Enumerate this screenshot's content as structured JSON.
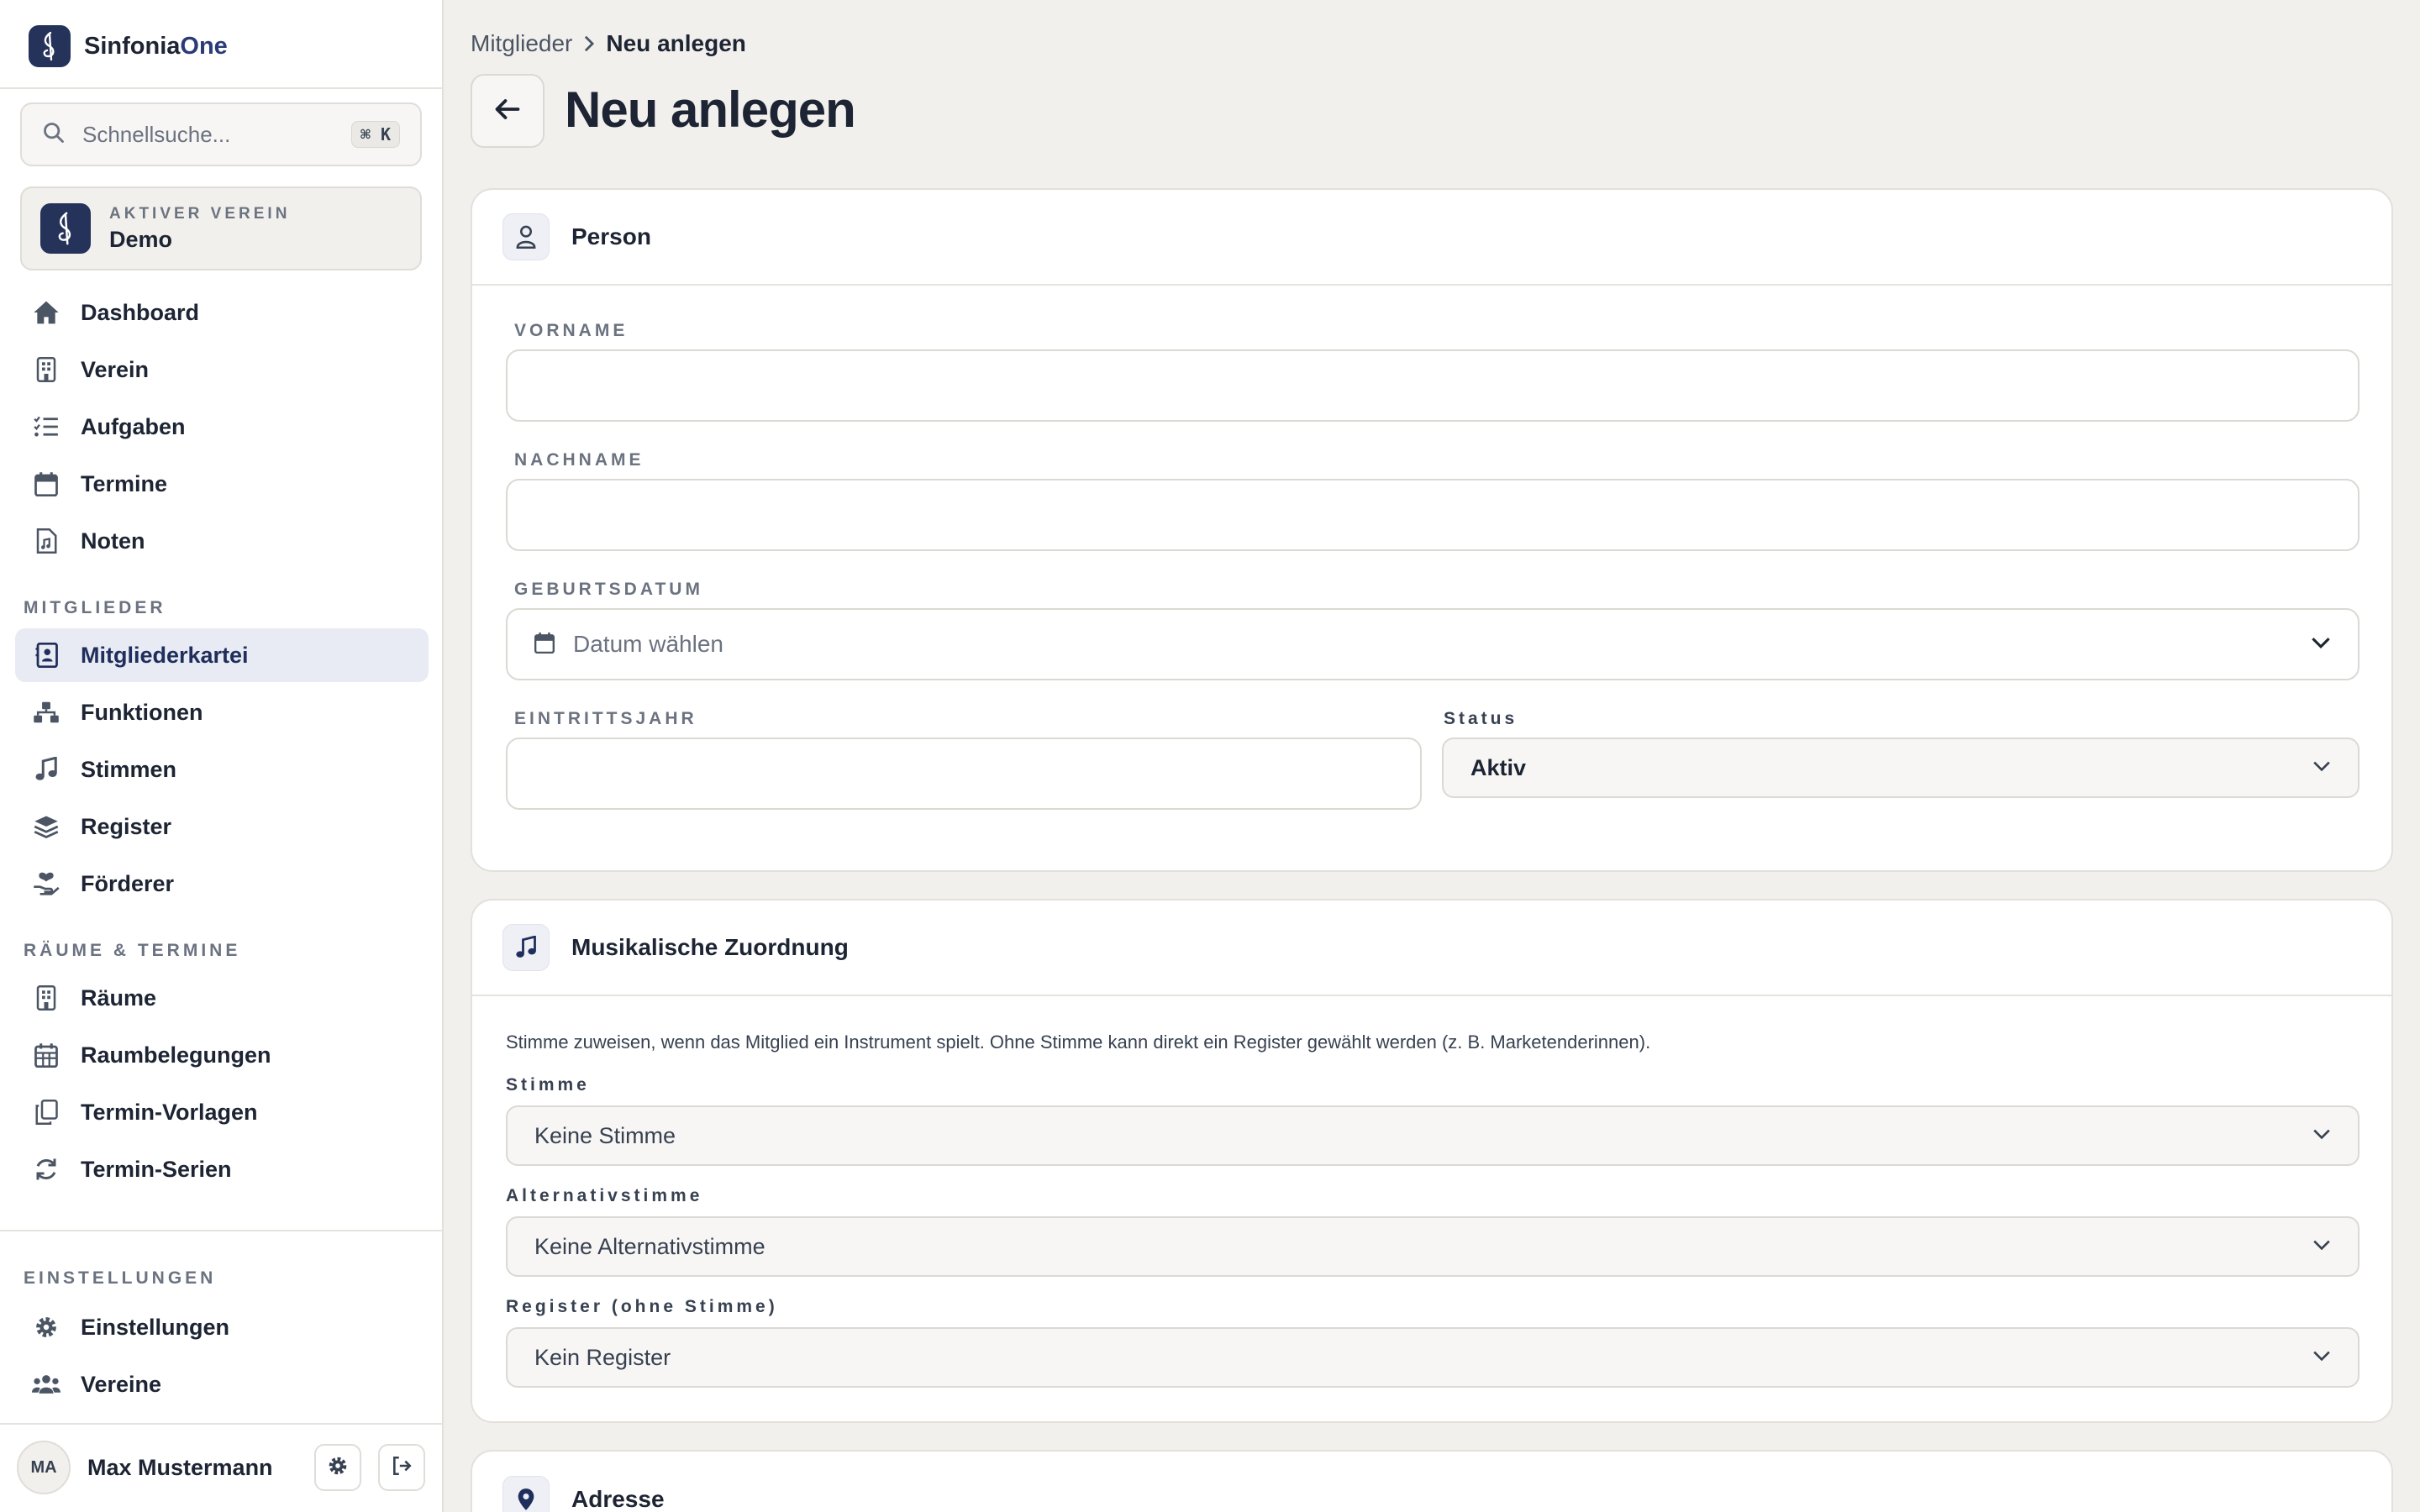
{
  "brand": {
    "name_part1": "Sinfonia",
    "name_part2": "One"
  },
  "search": {
    "placeholder": "Schnellsuche...",
    "shortcut": "⌘ K"
  },
  "active_club": {
    "label": "AKTIVER VEREIN",
    "name": "Demo"
  },
  "nav": {
    "main": [
      {
        "label": "Dashboard",
        "icon": "home-icon"
      },
      {
        "label": "Verein",
        "icon": "building-icon"
      },
      {
        "label": "Aufgaben",
        "icon": "list-check-icon"
      },
      {
        "label": "Termine",
        "icon": "calendar-icon"
      },
      {
        "label": "Noten",
        "icon": "sheet-music-icon"
      }
    ],
    "sections": [
      {
        "title": "MITGLIEDER",
        "items": [
          {
            "label": "Mitgliederkartei",
            "icon": "address-card-icon",
            "active": true
          },
          {
            "label": "Funktionen",
            "icon": "hierarchy-icon"
          },
          {
            "label": "Stimmen",
            "icon": "music-note-icon"
          },
          {
            "label": "Register",
            "icon": "layers-icon"
          },
          {
            "label": "Förderer",
            "icon": "hand-heart-icon"
          }
        ]
      },
      {
        "title": "RÄUME & TERMINE",
        "items": [
          {
            "label": "Räume",
            "icon": "building-icon"
          },
          {
            "label": "Raumbelegungen",
            "icon": "calendar-grid-icon"
          },
          {
            "label": "Termin-Vorlagen",
            "icon": "copy-icon"
          },
          {
            "label": "Termin-Serien",
            "icon": "refresh-icon"
          }
        ]
      },
      {
        "title": "EINSTELLUNGEN",
        "items": [
          {
            "label": "Einstellungen",
            "icon": "gear-icon"
          },
          {
            "label": "Vereine",
            "icon": "users-icon"
          }
        ]
      }
    ]
  },
  "user": {
    "initials": "MA",
    "name": "Max Mustermann"
  },
  "breadcrumb": {
    "parent": "Mitglieder",
    "current": "Neu anlegen"
  },
  "page": {
    "title": "Neu anlegen"
  },
  "person_card": {
    "title": "Person",
    "vorname_label": "VORNAME",
    "vorname_value": "",
    "nachname_label": "NACHNAME",
    "nachname_value": "",
    "geburtsdatum_label": "GEBURTSDATUM",
    "geburtsdatum_placeholder": "Datum wählen",
    "eintrittsjahr_label": "EINTRITTSJAHR",
    "eintrittsjahr_value": "",
    "status_label": "Status",
    "status_value": "Aktiv"
  },
  "music_card": {
    "title": "Musikalische Zuordnung",
    "hint": "Stimme zuweisen, wenn das Mitglied ein Instrument spielt. Ohne Stimme kann direkt ein Register gewählt werden (z. B. Marketenderinnen).",
    "stimme_label": "Stimme",
    "stimme_value": "Keine Stimme",
    "alt_label": "Alternativstimme",
    "alt_value": "Keine Alternativstimme",
    "register_label": "Register (ohne Stimme)",
    "register_value": "Kein Register"
  },
  "address_card": {
    "title": "Adresse"
  },
  "colors": {
    "brand": "#25325a",
    "accent": "#2a3b78",
    "background": "#f2f0ed",
    "active_nav": "#e8ebf3"
  }
}
